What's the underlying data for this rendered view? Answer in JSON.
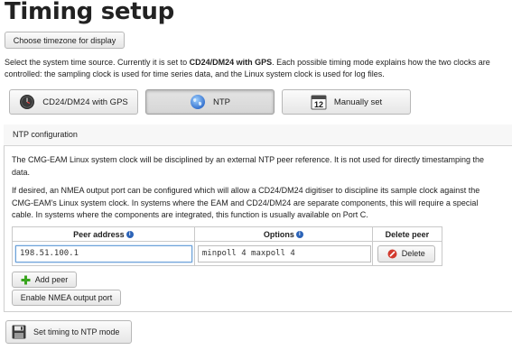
{
  "page": {
    "title": "Timing setup",
    "timezone_button": "Choose timezone for display",
    "intro_prefix": "Select the system time source. Currently it is set to ",
    "intro_current": "CD24/DM24 with GPS",
    "intro_suffix": ". Each possible timing mode explains how the two clocks are controlled: the sampling clock is used for time series data, and the Linux system clock is used for log files."
  },
  "modes": [
    {
      "label": "CD24/DM24 with GPS",
      "icon": "clock-icon"
    },
    {
      "label": "NTP",
      "icon": "globe-icon"
    },
    {
      "label": "Manually set",
      "icon": "calendar-icon",
      "icon_text": "12"
    }
  ],
  "ntp": {
    "heading": "NTP configuration",
    "para1": "The CMG-EAM Linux system clock will be disciplined by an external NTP peer reference. It is not used for directly timestamping the data.",
    "para2": "If desired, an NMEA output port can be configured which will allow a CD24/DM24 digitiser to discipline its sample clock against the CMG-EAM's Linux system clock. In systems where the EAM and CD24/DM24 are separate components, this will require a special cable. In systems where the components are integrated, this function is usually available on Port C.",
    "table": {
      "headers": [
        "Peer address",
        "Options",
        "Delete peer"
      ],
      "rows": [
        {
          "address": "198.51.100.1",
          "options": "minpoll 4 maxpoll 4",
          "delete_label": "Delete"
        }
      ]
    },
    "add_peer_label": "Add peer",
    "nmea_label": "Enable NMEA output port"
  },
  "footer": {
    "save_label": "Set timing to NTP mode"
  },
  "colors": {
    "accent_blue": "#2d64b8",
    "add_green": "#3aa51f",
    "delete_red": "#d23a2e"
  }
}
